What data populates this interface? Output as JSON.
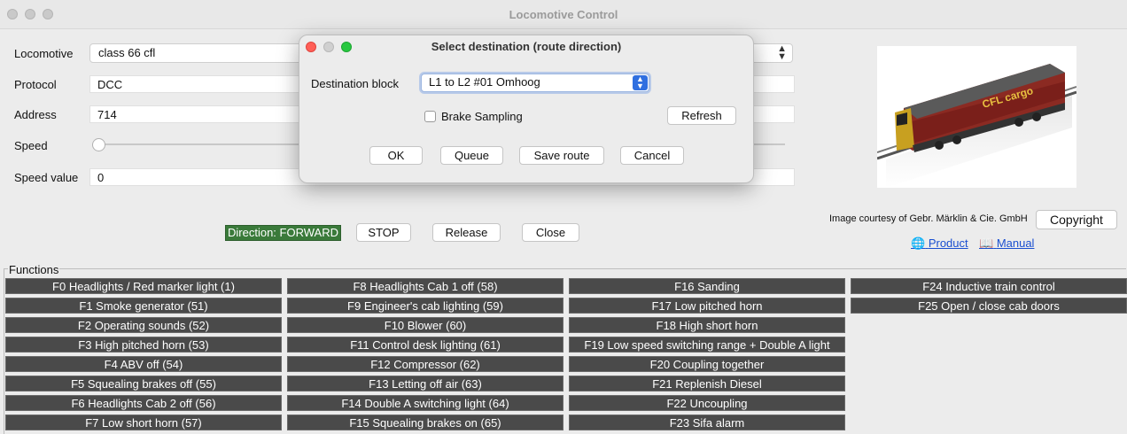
{
  "window": {
    "title": "Locomotive Control"
  },
  "form": {
    "locomotive_label": "Locomotive",
    "locomotive_value": "class 66 cfl",
    "protocol_label": "Protocol",
    "protocol_value": "DCC",
    "address_label": "Address",
    "address_value": "714",
    "speed_label": "Speed",
    "speed_level": 0,
    "speed_value_label": "Speed value",
    "speed_value": "0"
  },
  "controls": {
    "direction_label": "Direction: FORWARD",
    "stop_label": "STOP",
    "release_label": "Release",
    "close_label": "Close"
  },
  "image_panel": {
    "logo_text": "CFL cargo",
    "credit": "Image courtesy of Gebr. Märklin & Cie. GmbH",
    "copyright_label": "Copyright",
    "product_label": "Product",
    "manual_label": "Manual"
  },
  "functions": {
    "legend": "Functions",
    "columns": [
      [
        "F0  Headlights / Red marker light (1)",
        "F1  Smoke generator (51)",
        "F2  Operating sounds (52)",
        "F3  High pitched horn (53)",
        "F4  ABV off (54)",
        "F5  Squealing brakes off (55)",
        "F6  Headlights Cab 2 off (56)",
        "F7  Low short horn (57)"
      ],
      [
        "F8  Headlights Cab 1 off (58)",
        "F9  Engineer's cab lighting (59)",
        "F10  Blower (60)",
        "F11  Control desk lighting (61)",
        "F12  Compressor (62)",
        "F13  Letting off air (63)",
        "F14  Double A switching light (64)",
        "F15  Squealing brakes on (65)"
      ],
      [
        "F16  Sanding",
        "F17  Low pitched horn",
        "F18  High short horn",
        "F19  Low speed switching range + Double A light",
        "F20  Coupling together",
        "F21  Replenish Diesel",
        "F22  Uncoupling",
        "F23  Sifa alarm"
      ],
      [
        "F24  Inductive train control",
        "F25  Open / close cab doors"
      ]
    ]
  },
  "dialog": {
    "title": "Select destination (route direction)",
    "destination_label": "Destination block",
    "destination_value": "L1 to L2 #01 Omhoog",
    "brake_sampling_label": "Brake Sampling",
    "refresh_label": "Refresh",
    "ok_label": "OK",
    "queue_label": "Queue",
    "save_route_label": "Save route",
    "cancel_label": "Cancel"
  },
  "colors": {
    "direction_bg": "#3a7a3a",
    "function_button_bg": "#4a4a4a",
    "link": "#1a4fd0",
    "close_red": "#ff5f57",
    "minimize_yellow": "#febc2e",
    "zoom_green": "#28c840"
  }
}
